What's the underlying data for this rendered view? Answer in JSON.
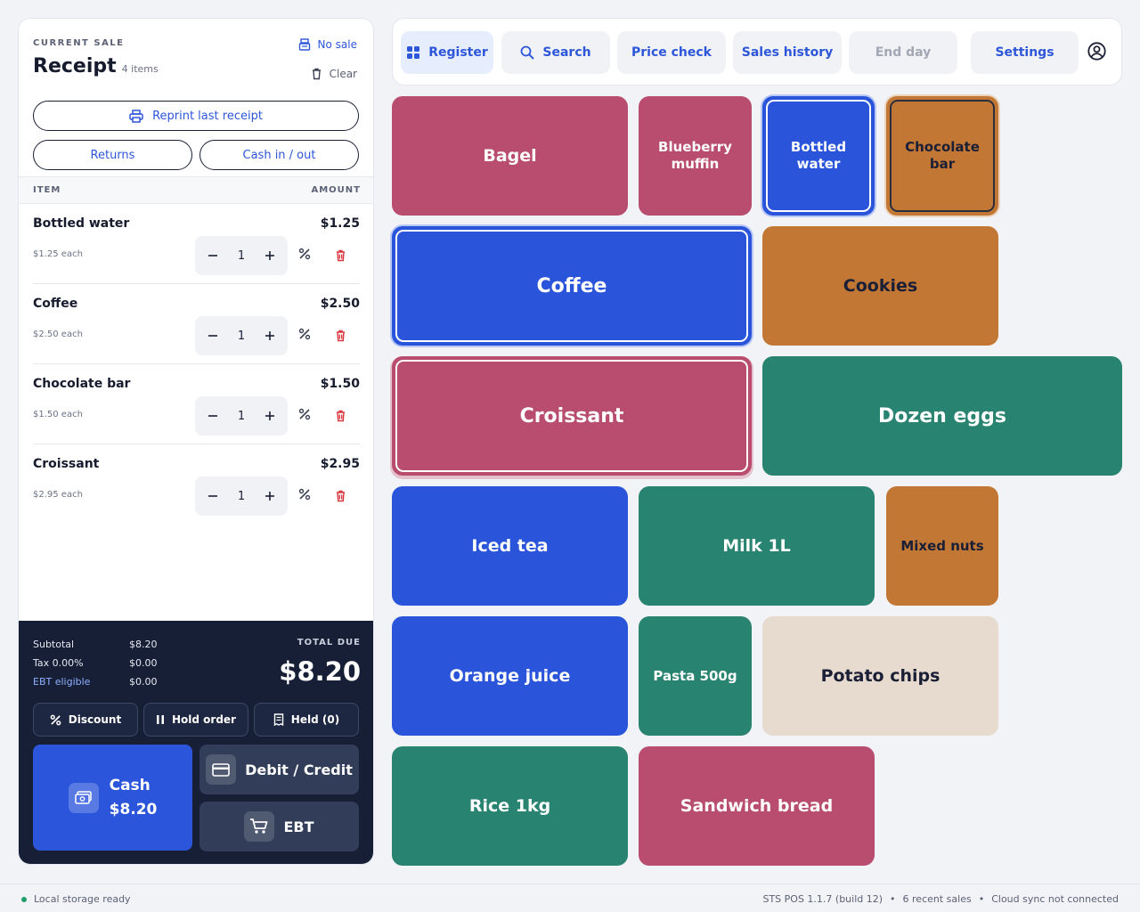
{
  "receipt": {
    "section_label": "CURRENT SALE",
    "title": "Receipt",
    "count": "4 items",
    "no_sale": "No sale",
    "clear": "Clear",
    "reprint": "Reprint last receipt",
    "returns": "Returns",
    "cash_in_out": "Cash in / out",
    "col_item": "ITEM",
    "col_amount": "AMOUNT",
    "items": [
      {
        "name": "Bottled water",
        "price": "$1.25",
        "each": "$1.25 each",
        "qty": "1"
      },
      {
        "name": "Coffee",
        "price": "$2.50",
        "each": "$2.50 each",
        "qty": "1"
      },
      {
        "name": "Chocolate bar",
        "price": "$1.50",
        "each": "$1.50 each",
        "qty": "1"
      },
      {
        "name": "Croissant",
        "price": "$2.95",
        "each": "$2.95 each",
        "qty": "1"
      }
    ]
  },
  "totals": {
    "subtotal_label": "Subtotal",
    "subtotal": "$8.20",
    "tax_label": "Tax 0.00%",
    "tax": "$0.00",
    "ebt_label": "EBT eligible",
    "ebt": "$0.00",
    "total_due_label": "TOTAL DUE",
    "total_due": "$8.20"
  },
  "actions": {
    "discount": "Discount",
    "hold_order": "Hold order",
    "held": "Held (0)"
  },
  "payment": {
    "cash_label": "Cash",
    "cash_amount": "$8.20",
    "card_label": "Debit / Credit",
    "ebt_label": "EBT"
  },
  "toolbar": {
    "register": "Register",
    "search": "Search",
    "price_check": "Price check",
    "sales_history": "Sales history",
    "end_day": "End day",
    "settings": "Settings"
  },
  "tiles": [
    {
      "name": "Bagel"
    },
    {
      "name": "Blueberry muffin",
      "line1": "Blueberry",
      "line2": "muffin"
    },
    {
      "name": "Bottled water",
      "line1": "Bottled",
      "line2": "water"
    },
    {
      "name": "Chocolate bar",
      "line1": "Chocolate",
      "line2": "bar"
    },
    {
      "name": "Coffee"
    },
    {
      "name": "Cookies"
    },
    {
      "name": "Croissant"
    },
    {
      "name": "Dozen eggs"
    },
    {
      "name": "Iced tea"
    },
    {
      "name": "Milk 1L"
    },
    {
      "name": "Mixed nuts"
    },
    {
      "name": "Orange juice"
    },
    {
      "name": "Pasta 500g"
    },
    {
      "name": "Potato chips"
    },
    {
      "name": "Rice 1kg"
    },
    {
      "name": "Sandwich bread"
    }
  ],
  "colors": {
    "accent": "#2d56d9",
    "rose": "#b84d70",
    "blue": "#2a55da",
    "amber": "#c27735",
    "green": "#288470",
    "beige": "#e7dbcf",
    "dark_panel": "#171f37"
  },
  "status": {
    "local": "Local storage ready",
    "version": "STS POS 1.1.7 (build 12)",
    "recent": "6 recent sales",
    "cloud": "Cloud sync not connected",
    "sep": "•"
  }
}
